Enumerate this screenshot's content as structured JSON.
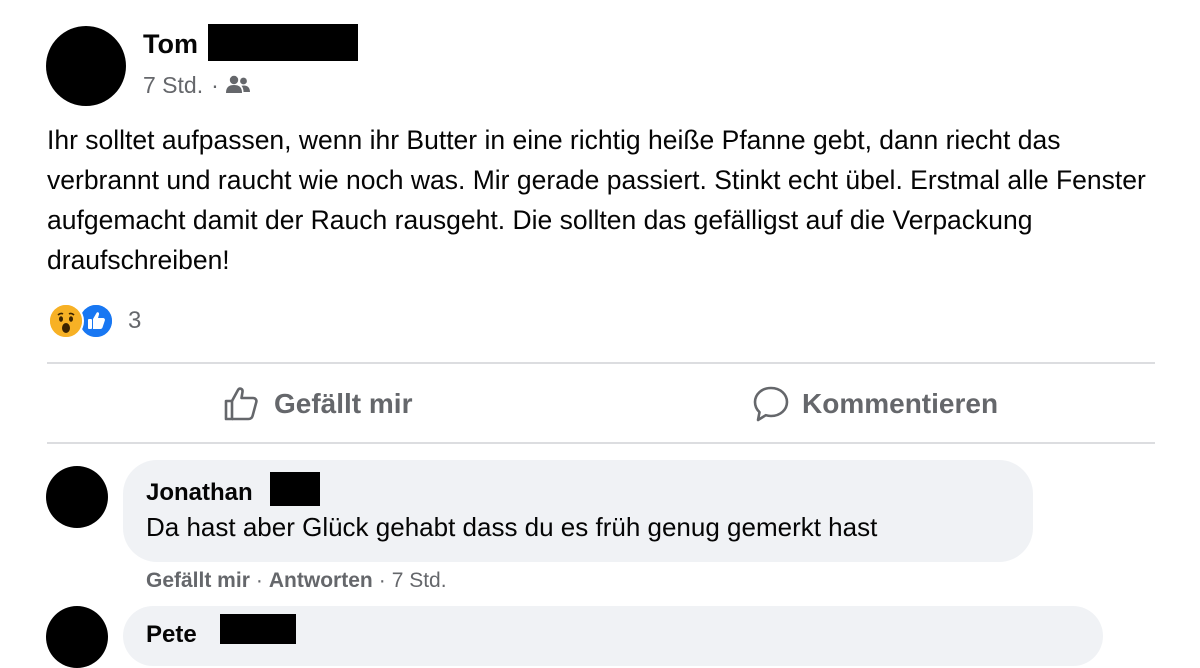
{
  "post": {
    "author_first_name": "Tom",
    "timestamp": "7 Std.",
    "separator": "·",
    "audience_icon": "friends-icon",
    "text": "Ihr solltet aufpassen, wenn ihr Butter in eine richtig heiße Pfanne gebt, dann riecht das verbrannt und raucht wie noch was. Mir gerade passiert. Stinkt echt übel. Erstmal alle Fenster aufgemacht damit der Rauch rausgeht. Die sollten das gefälligst auf die Verpackung draufschreiben!",
    "reactions": {
      "icons": [
        "wow-reaction-icon",
        "like-reaction-icon"
      ],
      "count": "3"
    }
  },
  "actions": {
    "like_label": "Gefällt mir",
    "comment_label": "Kommentieren"
  },
  "comments": [
    {
      "author_first_name": "Jonathan",
      "text": "Da hast aber Glück gehabt dass du es früh genug gemerkt hast",
      "like_label": "Gefällt mir",
      "reply_label": "Antworten",
      "separator": "·",
      "timestamp": "7 Std."
    },
    {
      "author_first_name": "Pete"
    }
  ],
  "colors": {
    "secondary_text": "#65676b",
    "comment_bubble": "#f0f2f5",
    "like_blue": "#1877f2",
    "wow_yellow": "#f7b125",
    "divider": "#dcdde0"
  }
}
